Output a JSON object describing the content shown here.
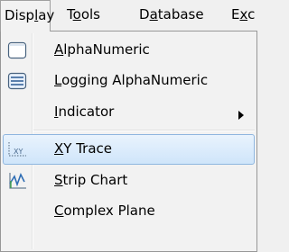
{
  "menubar": {
    "display": {
      "pre": "Disp",
      "acc": "l",
      "post": "ay"
    },
    "tools": {
      "pre": "T",
      "acc": "o",
      "post": "ols"
    },
    "database": {
      "pre": "D",
      "acc": "a",
      "post": "tabase"
    },
    "partial": {
      "pre": "E",
      "acc": "x",
      "post": "c"
    }
  },
  "menu": {
    "items": [
      {
        "acc": "A",
        "rest": "lphaNumeric",
        "icon": "alphanumeric-window-icon"
      },
      {
        "acc": "L",
        "rest": "ogging AlphaNumeric",
        "icon": "logging-list-icon"
      },
      {
        "acc": "I",
        "rest": "ndicator",
        "icon": "none",
        "submenu": true
      },
      {
        "acc": "X",
        "rest": "Y Trace",
        "icon": "xy-trace-icon",
        "highlighted": true
      },
      {
        "acc": "S",
        "rest": "trip Chart",
        "icon": "strip-chart-icon"
      },
      {
        "acc": "C",
        "rest": "omplex Plane",
        "icon": "none"
      }
    ]
  }
}
